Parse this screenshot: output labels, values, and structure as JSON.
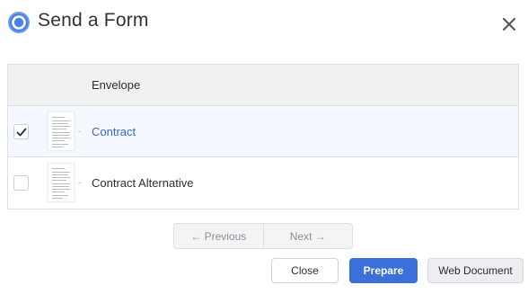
{
  "header": {
    "title": "Send a Form",
    "logo_icon": "circle-logo-icon",
    "close_icon": "close-icon"
  },
  "table": {
    "column_header": "Envelope",
    "rows": [
      {
        "label": "Contract",
        "checked": true
      },
      {
        "label": "Contract Alternative",
        "checked": false
      }
    ]
  },
  "pagination": {
    "previous_label": "← Previous",
    "next_label": "Next →"
  },
  "footer": {
    "close_label": "Close",
    "prepare_label": "Prepare",
    "web_document_label": "Web Document"
  },
  "colors": {
    "accent": "#3b6fd9",
    "link": "#3b66c4",
    "logo": "#5b8de8"
  }
}
